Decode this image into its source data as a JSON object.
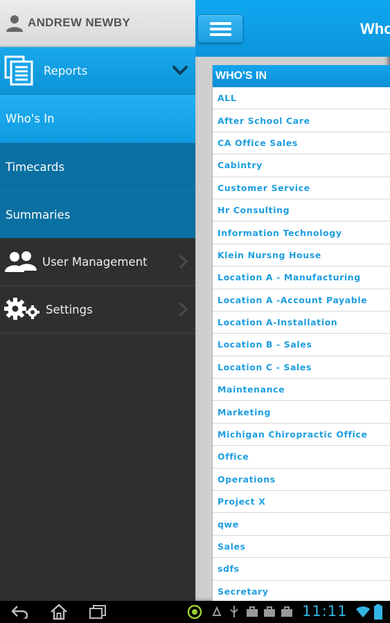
{
  "drawer": {
    "user_name": "ANDREW NEWBY",
    "reports_label": "Reports",
    "reports_sub": [
      {
        "label": "Who's In",
        "active": true
      },
      {
        "label": "Timecards",
        "active": false
      },
      {
        "label": "Summaries",
        "active": false
      }
    ],
    "user_management_label": "User Management",
    "settings_label": "Settings"
  },
  "main": {
    "title": "Who's In",
    "list_header": "WHO'S IN",
    "items": [
      "ALL",
      "After School Care",
      "CA Office Sales",
      "Cabintry",
      "Customer Service",
      "Hr Consulting",
      "Information Technology",
      "Klein Nursng House",
      "Location A - Manufacturing",
      "Location A -Account Payable",
      "Location A-Installation",
      "Location B - Sales",
      "Location C - Sales",
      "Maintenance",
      "Marketing",
      "Michigan Chiropractic Office",
      "Office",
      "Operations",
      "Project X",
      "qwe",
      "Sales",
      "sdfs",
      "Secretary"
    ]
  },
  "system_bar": {
    "clock": "11:11"
  },
  "colors": {
    "accent": "#0c9ae0",
    "link": "#1e9ee0",
    "drawer_bg": "#2f2f2f",
    "sub_item_bg": "#0a6fa1",
    "clock": "#33b5e5"
  },
  "icons": [
    "person-icon",
    "reports-icon",
    "chevron-down-icon",
    "users-icon",
    "chevron-right-icon",
    "gear-icon",
    "hamburger-icon",
    "back-icon",
    "home-icon",
    "recent-apps-icon",
    "wifi-icon",
    "battery-icon"
  ]
}
